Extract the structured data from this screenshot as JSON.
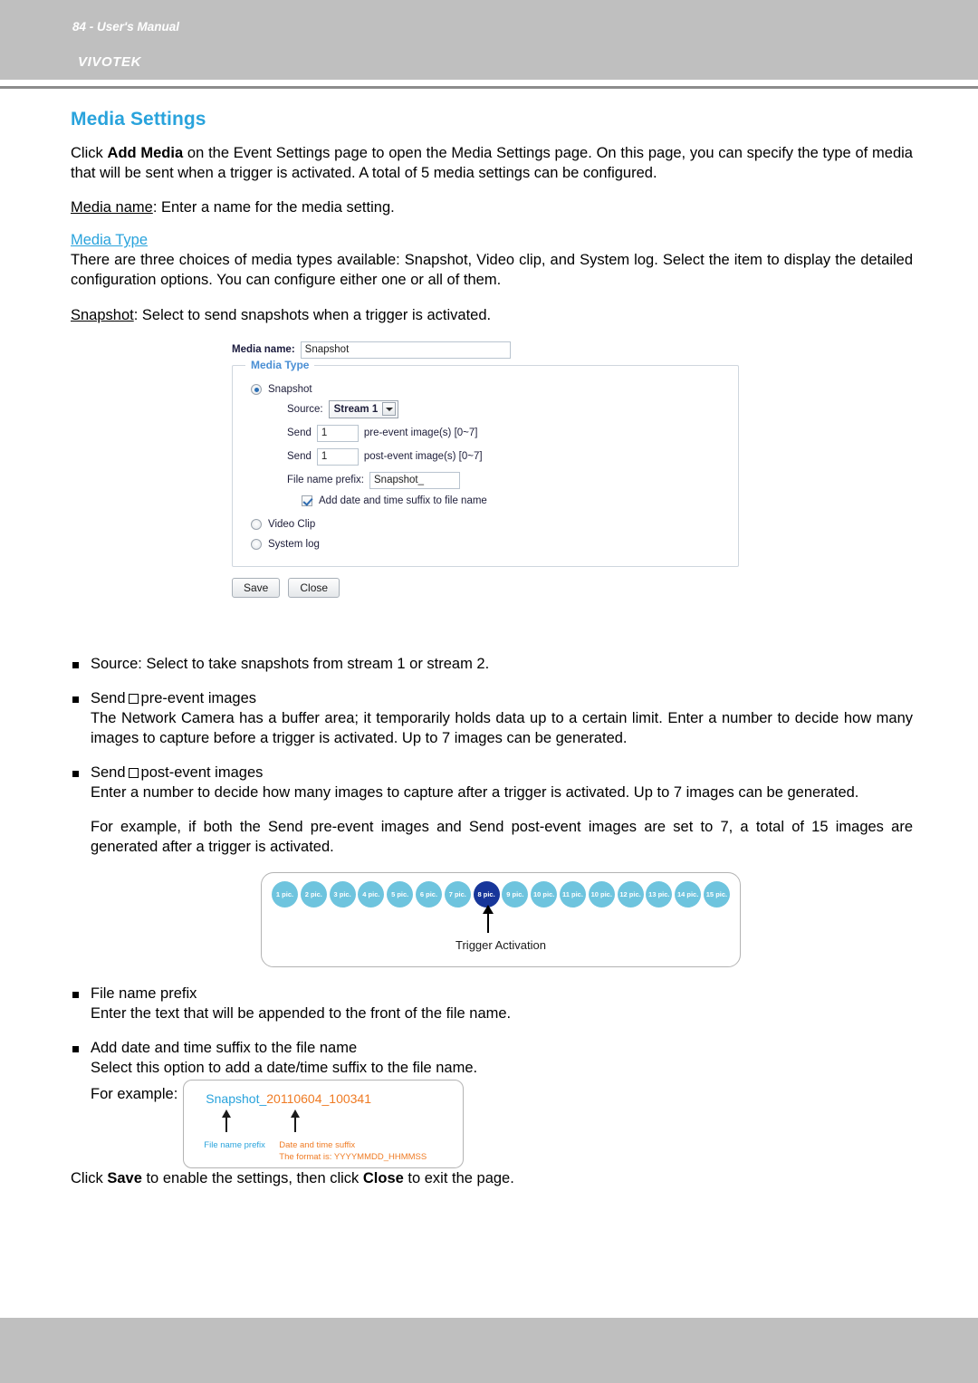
{
  "header": {
    "brand": "VIVOTEK"
  },
  "page": {
    "title": "Media Settings",
    "intro": {
      "pre": "Click ",
      "bold1": "Add Media",
      "post": " on the Event Settings page to open the Media Settings page. On this page, you can specify the type of media that will be sent when a trigger is activated. A total of 5 media settings can be configured."
    },
    "media_name_line": {
      "term": "Media name",
      "rest": ": Enter a name for the media setting."
    },
    "media_type_heading": "Media Type",
    "media_type_body": "There are three choices of media types available: Snapshot, Video clip, and System log. Select the item to display the detailed configuration options. You can configure either one or all of them.",
    "snapshot_line": {
      "term": "Snapshot",
      "rest": ": Select to send snapshots when a trigger is activated."
    },
    "example_paragraph": "For example, if both the Send pre-event images and Send post-event images are set to 7, a total of 15 images are generated after a trigger is activated.",
    "closing": {
      "pre": "Click ",
      "bold1": "Save",
      "mid": " to enable the settings, then click ",
      "bold2": "Close",
      "post": " to exit the page."
    }
  },
  "ui_form": {
    "media_name_label": "Media name:",
    "media_name_value": "Snapshot",
    "legend": "Media Type",
    "options": {
      "snapshot": "Snapshot",
      "video_clip": "Video Clip",
      "system_log": "System log"
    },
    "source_label": "Source:",
    "source_value": "Stream 1",
    "send_label": "Send",
    "pre_event_value": "1",
    "pre_event_suffix": "pre-event image(s) [0~7]",
    "post_event_value": "1",
    "post_event_suffix": "post-event image(s) [0~7]",
    "file_name_prefix_label": "File name prefix:",
    "file_name_prefix_value": "Snapshot_",
    "add_suffix_checkbox_label": "Add date and time suffix to file name",
    "buttons": {
      "save": "Save",
      "close": "Close"
    }
  },
  "bullets": [
    {
      "head": "Source: Select to take snapshots from stream 1 or stream 2.",
      "body": ""
    },
    {
      "head_pre": "Send",
      "head_post": "pre-event images",
      "body": "The Network Camera has a buffer area; it temporarily holds data up to a certain limit. Enter a number to decide how many images to capture before a trigger is activated. Up to 7 images can be generated."
    },
    {
      "head_pre": "Send",
      "head_post": "post-event images",
      "body": "Enter a number to decide how many images to capture after a trigger is activated. Up to 7 images can be generated."
    },
    {
      "head": "File name prefix",
      "body": "Enter the text that will be appended to the front of the file name."
    },
    {
      "head": "Add date and time suffix to the file name",
      "body": "Select this option to add a date/time suffix to the file name."
    }
  ],
  "timeline": {
    "dots": [
      "1 pic.",
      "2 pic.",
      "3 pic.",
      "4 pic.",
      "5 pic.",
      "6 pic.",
      "7 pic.",
      "8 pic.",
      "9 pic.",
      "10 pic.",
      "11 pic.",
      "10 pic.",
      "12 pic.",
      "13 pic.",
      "14 pic.",
      "15 pic."
    ],
    "active_index": 7,
    "trigger_label": "Trigger Activation",
    "dot_color": "#6EC4DE",
    "active_color": "#17369A"
  },
  "filename_example": {
    "for_example_label": "For example:",
    "prefix_text": "Snapshot_",
    "suffix_text": "20110604_100341",
    "caption_prefix": "File name prefix",
    "caption_suffix": "Date and time suffix",
    "caption_format": "The format is: YYYYMMDD_HHMMSS",
    "prefix_color": "#29A3DC",
    "suffix_color": "#EF7B24"
  },
  "footer": {
    "text": "84 - User's Manual"
  }
}
